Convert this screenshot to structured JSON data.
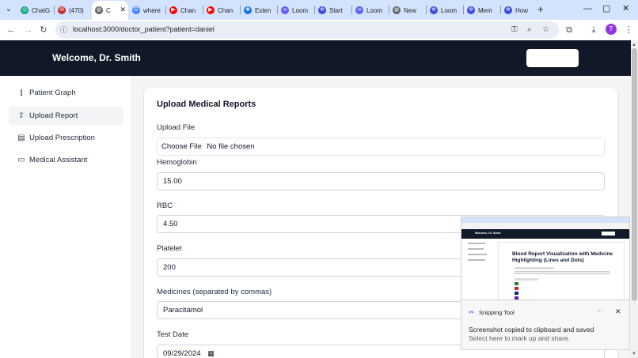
{
  "browser": {
    "tabs": [
      {
        "label": "ChatG",
        "favicon": "chatgpt-icon",
        "color": "#10a37f",
        "glyph": "◎"
      },
      {
        "label": "(470)",
        "favicon": "youtube-icon",
        "color": "#c4302b",
        "glyph": "✉"
      },
      {
        "label": "C",
        "favicon": "globe-icon",
        "color": "#5f6368",
        "glyph": "◍",
        "active": true
      },
      {
        "label": "where",
        "favicon": "google-icon",
        "color": "#4285f4",
        "glyph": "G"
      },
      {
        "label": "Chan",
        "favicon": "youtube-icon",
        "color": "#ff0000",
        "glyph": "▶"
      },
      {
        "label": "Chan",
        "favicon": "youtube-icon",
        "color": "#ff0000",
        "glyph": "▶"
      },
      {
        "label": "Exten",
        "favicon": "puzzle-icon",
        "color": "#1a73e8",
        "glyph": "✚"
      },
      {
        "label": "Loom",
        "favicon": "loom-icon",
        "color": "#625df5",
        "glyph": "∞"
      },
      {
        "label": "Start",
        "favicon": "settings-icon",
        "color": "#3c4bdc",
        "glyph": "✲"
      },
      {
        "label": "Loom",
        "favicon": "loom-icon",
        "color": "#625df5",
        "glyph": "∞"
      },
      {
        "label": "New",
        "favicon": "globe-icon",
        "color": "#5f6368",
        "glyph": "◍"
      },
      {
        "label": "Loom",
        "favicon": "settings-icon",
        "color": "#3c4bdc",
        "glyph": "✲"
      },
      {
        "label": "Mem",
        "favicon": "settings-icon",
        "color": "#3c4bdc",
        "glyph": "✲"
      },
      {
        "label": "How",
        "favicon": "settings-icon",
        "color": "#3c4bdc",
        "glyph": "✲"
      }
    ],
    "new_tab": "+",
    "url": "localhost:3000/doctor_patient?patient=daniel",
    "profile_initial": "T",
    "icons": {
      "back": "←",
      "forward": "→",
      "reload": "↻",
      "site_info": "ⓘ",
      "password": "⚿",
      "zoom": "⌕",
      "star": "☆",
      "extensions": "⧉",
      "download": "⤓",
      "menu": "⋮",
      "minimize": "—",
      "maximize": "▢",
      "close": "✕",
      "tab_search": "⌄"
    }
  },
  "header": {
    "welcome": "Welcome, Dr. Smith",
    "bg_color": "#111827"
  },
  "sidebar": {
    "items": [
      {
        "label": "Patient Graph",
        "icon": "bar-chart-icon",
        "glyph": "⫾"
      },
      {
        "label": "Upload Report",
        "icon": "upload-icon",
        "glyph": "⇪",
        "active": true
      },
      {
        "label": "Upload Prescription",
        "icon": "document-icon",
        "glyph": "▤"
      },
      {
        "label": "Medical Assistant",
        "icon": "chat-icon",
        "glyph": "▭"
      }
    ]
  },
  "main": {
    "title": "Upload Medical Reports",
    "upload_label": "Upload File",
    "file_button": "Choose File",
    "file_status": "No file chosen",
    "hemoglobin_label": "Hemoglobin",
    "hemoglobin_value": "15.00",
    "rbc_label": "RBC",
    "rbc_value": "4.50",
    "platelet_label": "Platelet",
    "platelet_value": "200",
    "medicines_label": "Medicines (separated by commas)",
    "medicines_value": "Paracitamol",
    "test_date_label": "Test Date",
    "test_date_value": "09/29/2024",
    "calendar_icon": "▦"
  },
  "snipping": {
    "thumbnail": {
      "welcome": "Welcome, Dr. Smith",
      "title": "Blood Report Visualization with Medicine Highlighting (Lines and Dots)"
    },
    "app_name": "Snipping Tool",
    "app_icon": "✂",
    "more": "···",
    "close": "✕",
    "message": "Screenshot copied to clipboard and saved",
    "sub_message": "Select here to mark up and share."
  }
}
